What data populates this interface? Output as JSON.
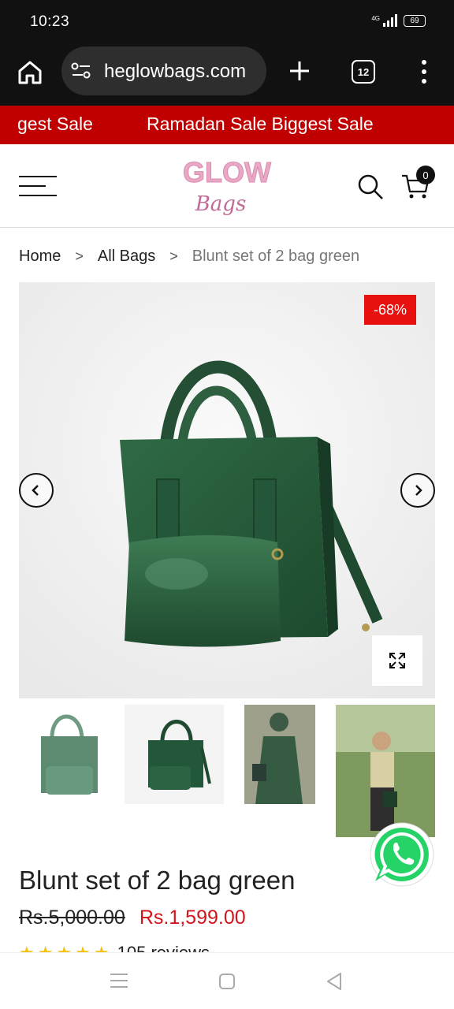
{
  "status_bar": {
    "time": "10:23",
    "network": "4G",
    "battery": "69"
  },
  "browser": {
    "url": "heglowbags.com",
    "tab_count": "12"
  },
  "marquee": {
    "items": [
      "gest Sale",
      "Ramadan Sale Biggest Sale"
    ],
    "background": "#c00000"
  },
  "header": {
    "logo_top": "GLOW",
    "logo_script": "Bags",
    "cart_count": "0"
  },
  "breadcrumb": {
    "items": [
      "Home",
      "All Bags",
      "Blunt set of 2 bag green"
    ]
  },
  "product": {
    "discount": "-68%",
    "title": "Blunt set of 2 bag green",
    "old_price": "Rs.5,000.00",
    "new_price": "Rs.1,599.00",
    "stars": "★★★★★",
    "rating_value": 5,
    "reviews_text": "105 reviews",
    "accent_color": "#d0151b"
  },
  "icons": {
    "home": "home-icon",
    "site_settings": "site-settings-icon",
    "new_tab": "plus-icon",
    "menu": "more-vert-icon",
    "hamburger": "hamburger-icon",
    "search": "search-icon",
    "cart": "cart-icon",
    "prev": "chevron-left-icon",
    "next": "chevron-right-icon",
    "zoom": "expand-icon",
    "whatsapp": "whatsapp-icon"
  }
}
